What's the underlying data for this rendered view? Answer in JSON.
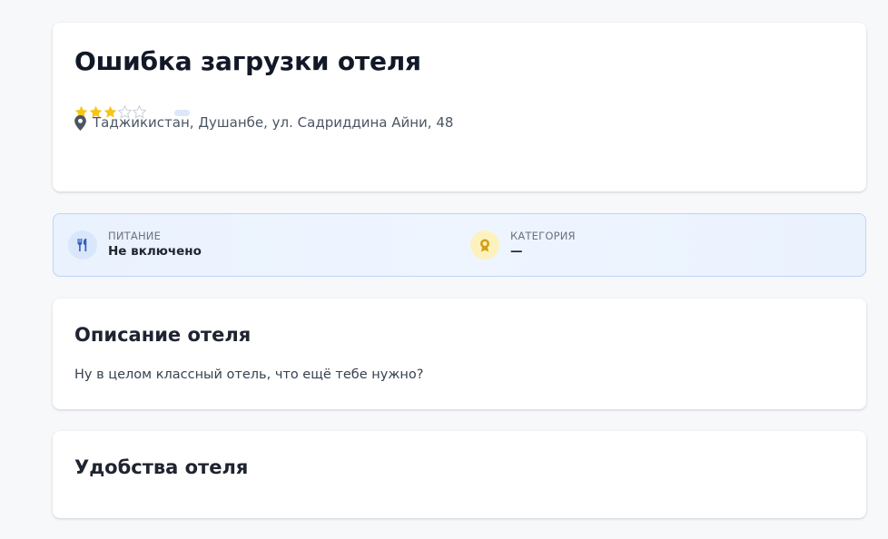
{
  "hotel": {
    "title": "Ошибка загрузки отеля",
    "rating": 3,
    "rating_max": 5,
    "address": "Таджикистан, Душанбе, ул. Садриддина Айни, 48"
  },
  "info": {
    "meal": {
      "label": "ПИТАНИЕ",
      "value": "Не включено",
      "icon": "utensils-icon"
    },
    "category": {
      "label": "КАТЕГОРИЯ",
      "value": "—",
      "icon": "award-badge-icon"
    }
  },
  "description": {
    "title": "Описание отеля",
    "text": "Ну в целом классный отель, что ещё тебе нужно?"
  },
  "amenities": {
    "title": "Удобства отеля"
  },
  "colors": {
    "star_filled": "#f5c518",
    "star_empty": "#c9ced6",
    "info_border": "#bcd5f7",
    "meal_icon": "#2f5fb3",
    "category_icon": "#d4a017"
  }
}
